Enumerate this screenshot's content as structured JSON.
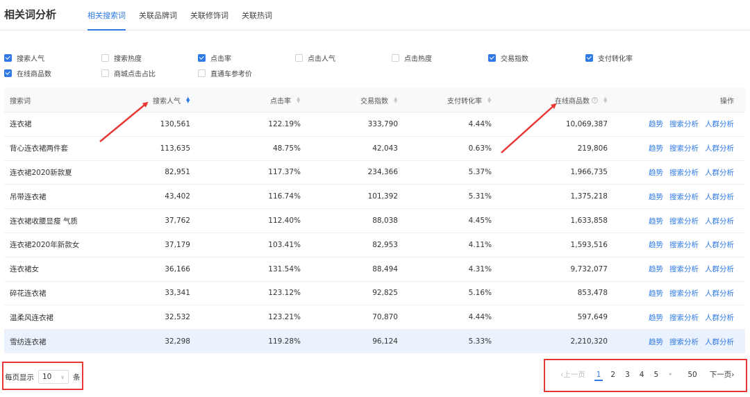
{
  "page_title": "相关词分析",
  "tabs": [
    {
      "label": "相关搜索词",
      "active": true
    },
    {
      "label": "关联品牌词",
      "active": false
    },
    {
      "label": "关联修饰词",
      "active": false
    },
    {
      "label": "关联热词",
      "active": false
    }
  ],
  "filters": [
    {
      "label": "搜索人气",
      "checked": true
    },
    {
      "label": "搜索热度",
      "checked": false
    },
    {
      "label": "点击率",
      "checked": true
    },
    {
      "label": "点击人气",
      "checked": false
    },
    {
      "label": "点击热度",
      "checked": false
    },
    {
      "label": "交易指数",
      "checked": true
    },
    {
      "label": "支付转化率",
      "checked": true
    },
    {
      "label": "在线商品数",
      "checked": true
    },
    {
      "label": "商城点击占比",
      "checked": false
    },
    {
      "label": "直通车参考价",
      "checked": false
    }
  ],
  "table": {
    "headers": [
      "搜索词",
      "搜索人气",
      "点击率",
      "交易指数",
      "支付转化率",
      "在线商品数",
      "操作"
    ],
    "info_icon": "info-circle-icon",
    "rows": [
      {
        "term": "连衣裙",
        "popularity": "130,561",
        "ctr": "122.19%",
        "trade_index": "333,790",
        "conversion": "4.44%",
        "online_items": "10,069,387"
      },
      {
        "term": "背心连衣裙两件套",
        "popularity": "113,635",
        "ctr": "48.75%",
        "trade_index": "42,043",
        "conversion": "0.63%",
        "online_items": "219,806"
      },
      {
        "term": "连衣裙2020新款夏",
        "popularity": "82,951",
        "ctr": "117.37%",
        "trade_index": "234,366",
        "conversion": "5.37%",
        "online_items": "1,966,735"
      },
      {
        "term": "吊带连衣裙",
        "popularity": "43,402",
        "ctr": "116.74%",
        "trade_index": "101,392",
        "conversion": "5.31%",
        "online_items": "1,375,218"
      },
      {
        "term": "连衣裙收腰显瘦 气质",
        "popularity": "37,762",
        "ctr": "112.40%",
        "trade_index": "88,038",
        "conversion": "4.45%",
        "online_items": "1,633,858"
      },
      {
        "term": "连衣裙2020年新款女",
        "popularity": "37,179",
        "ctr": "103.41%",
        "trade_index": "82,953",
        "conversion": "4.11%",
        "online_items": "1,593,516"
      },
      {
        "term": "连衣裙女",
        "popularity": "36,166",
        "ctr": "131.54%",
        "trade_index": "88,494",
        "conversion": "4.31%",
        "online_items": "9,732,077"
      },
      {
        "term": "碎花连衣裙",
        "popularity": "33,341",
        "ctr": "123.12%",
        "trade_index": "92,825",
        "conversion": "5.16%",
        "online_items": "853,478"
      },
      {
        "term": "温柔风连衣裙",
        "popularity": "32,532",
        "ctr": "123.21%",
        "trade_index": "70,870",
        "conversion": "4.44%",
        "online_items": "597,649"
      },
      {
        "term": "雪纺连衣裙",
        "popularity": "32,298",
        "ctr": "119.28%",
        "trade_index": "96,124",
        "conversion": "5.33%",
        "online_items": "2,210,320"
      }
    ],
    "row_actions": [
      "趋势",
      "搜索分析",
      "人群分析"
    ],
    "highlighted_row": 9
  },
  "page_size": {
    "prefix": "每页显示",
    "value": "10",
    "suffix": "条"
  },
  "pagination": {
    "prev_label": "上一页",
    "pages": [
      "1",
      "2",
      "3",
      "4",
      "5"
    ],
    "current_page": "1",
    "ellipsis": "•",
    "last_page": "50",
    "next_label": "下一页"
  },
  "colors": {
    "accent": "#2f7ae5",
    "annotation": "#e53935",
    "highlight_row": "#eaf2fd"
  }
}
